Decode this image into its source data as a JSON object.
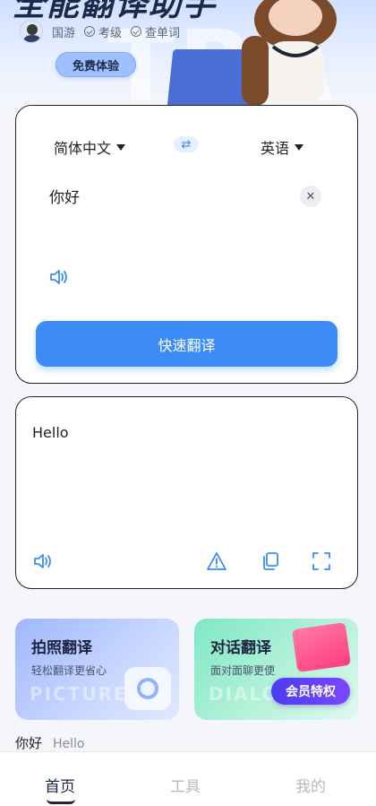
{
  "banner": {
    "headline": "全能翻译助手",
    "watermark": "TRA",
    "features": [
      "国游",
      "考级",
      "查单词"
    ],
    "trial_button": "免费体验"
  },
  "translator": {
    "source_lang": "简体中文",
    "target_lang": "英语",
    "swap_icon": "swap-arrows-icon",
    "input_text": "你好",
    "translate_button": "快速翻译"
  },
  "result": {
    "text": "Hello",
    "icons": [
      "speaker-icon",
      "warning-icon",
      "copy-icon",
      "fullscreen-icon"
    ]
  },
  "tiles": [
    {
      "title": "拍照翻译",
      "subtitle": "轻松翻译更省心",
      "watermark": "PICTURE"
    },
    {
      "title": "对话翻译",
      "subtitle": "面对面聊更便",
      "watermark": "DIALO",
      "badge": "会员特权"
    }
  ],
  "history": {
    "source": "你好",
    "target": "Hello"
  },
  "nav": {
    "home": "首页",
    "tools": "工具",
    "mine": "我的"
  },
  "colors": {
    "accent": "#3d8bf5",
    "text": "#222222",
    "muted": "#b5b9c2"
  }
}
